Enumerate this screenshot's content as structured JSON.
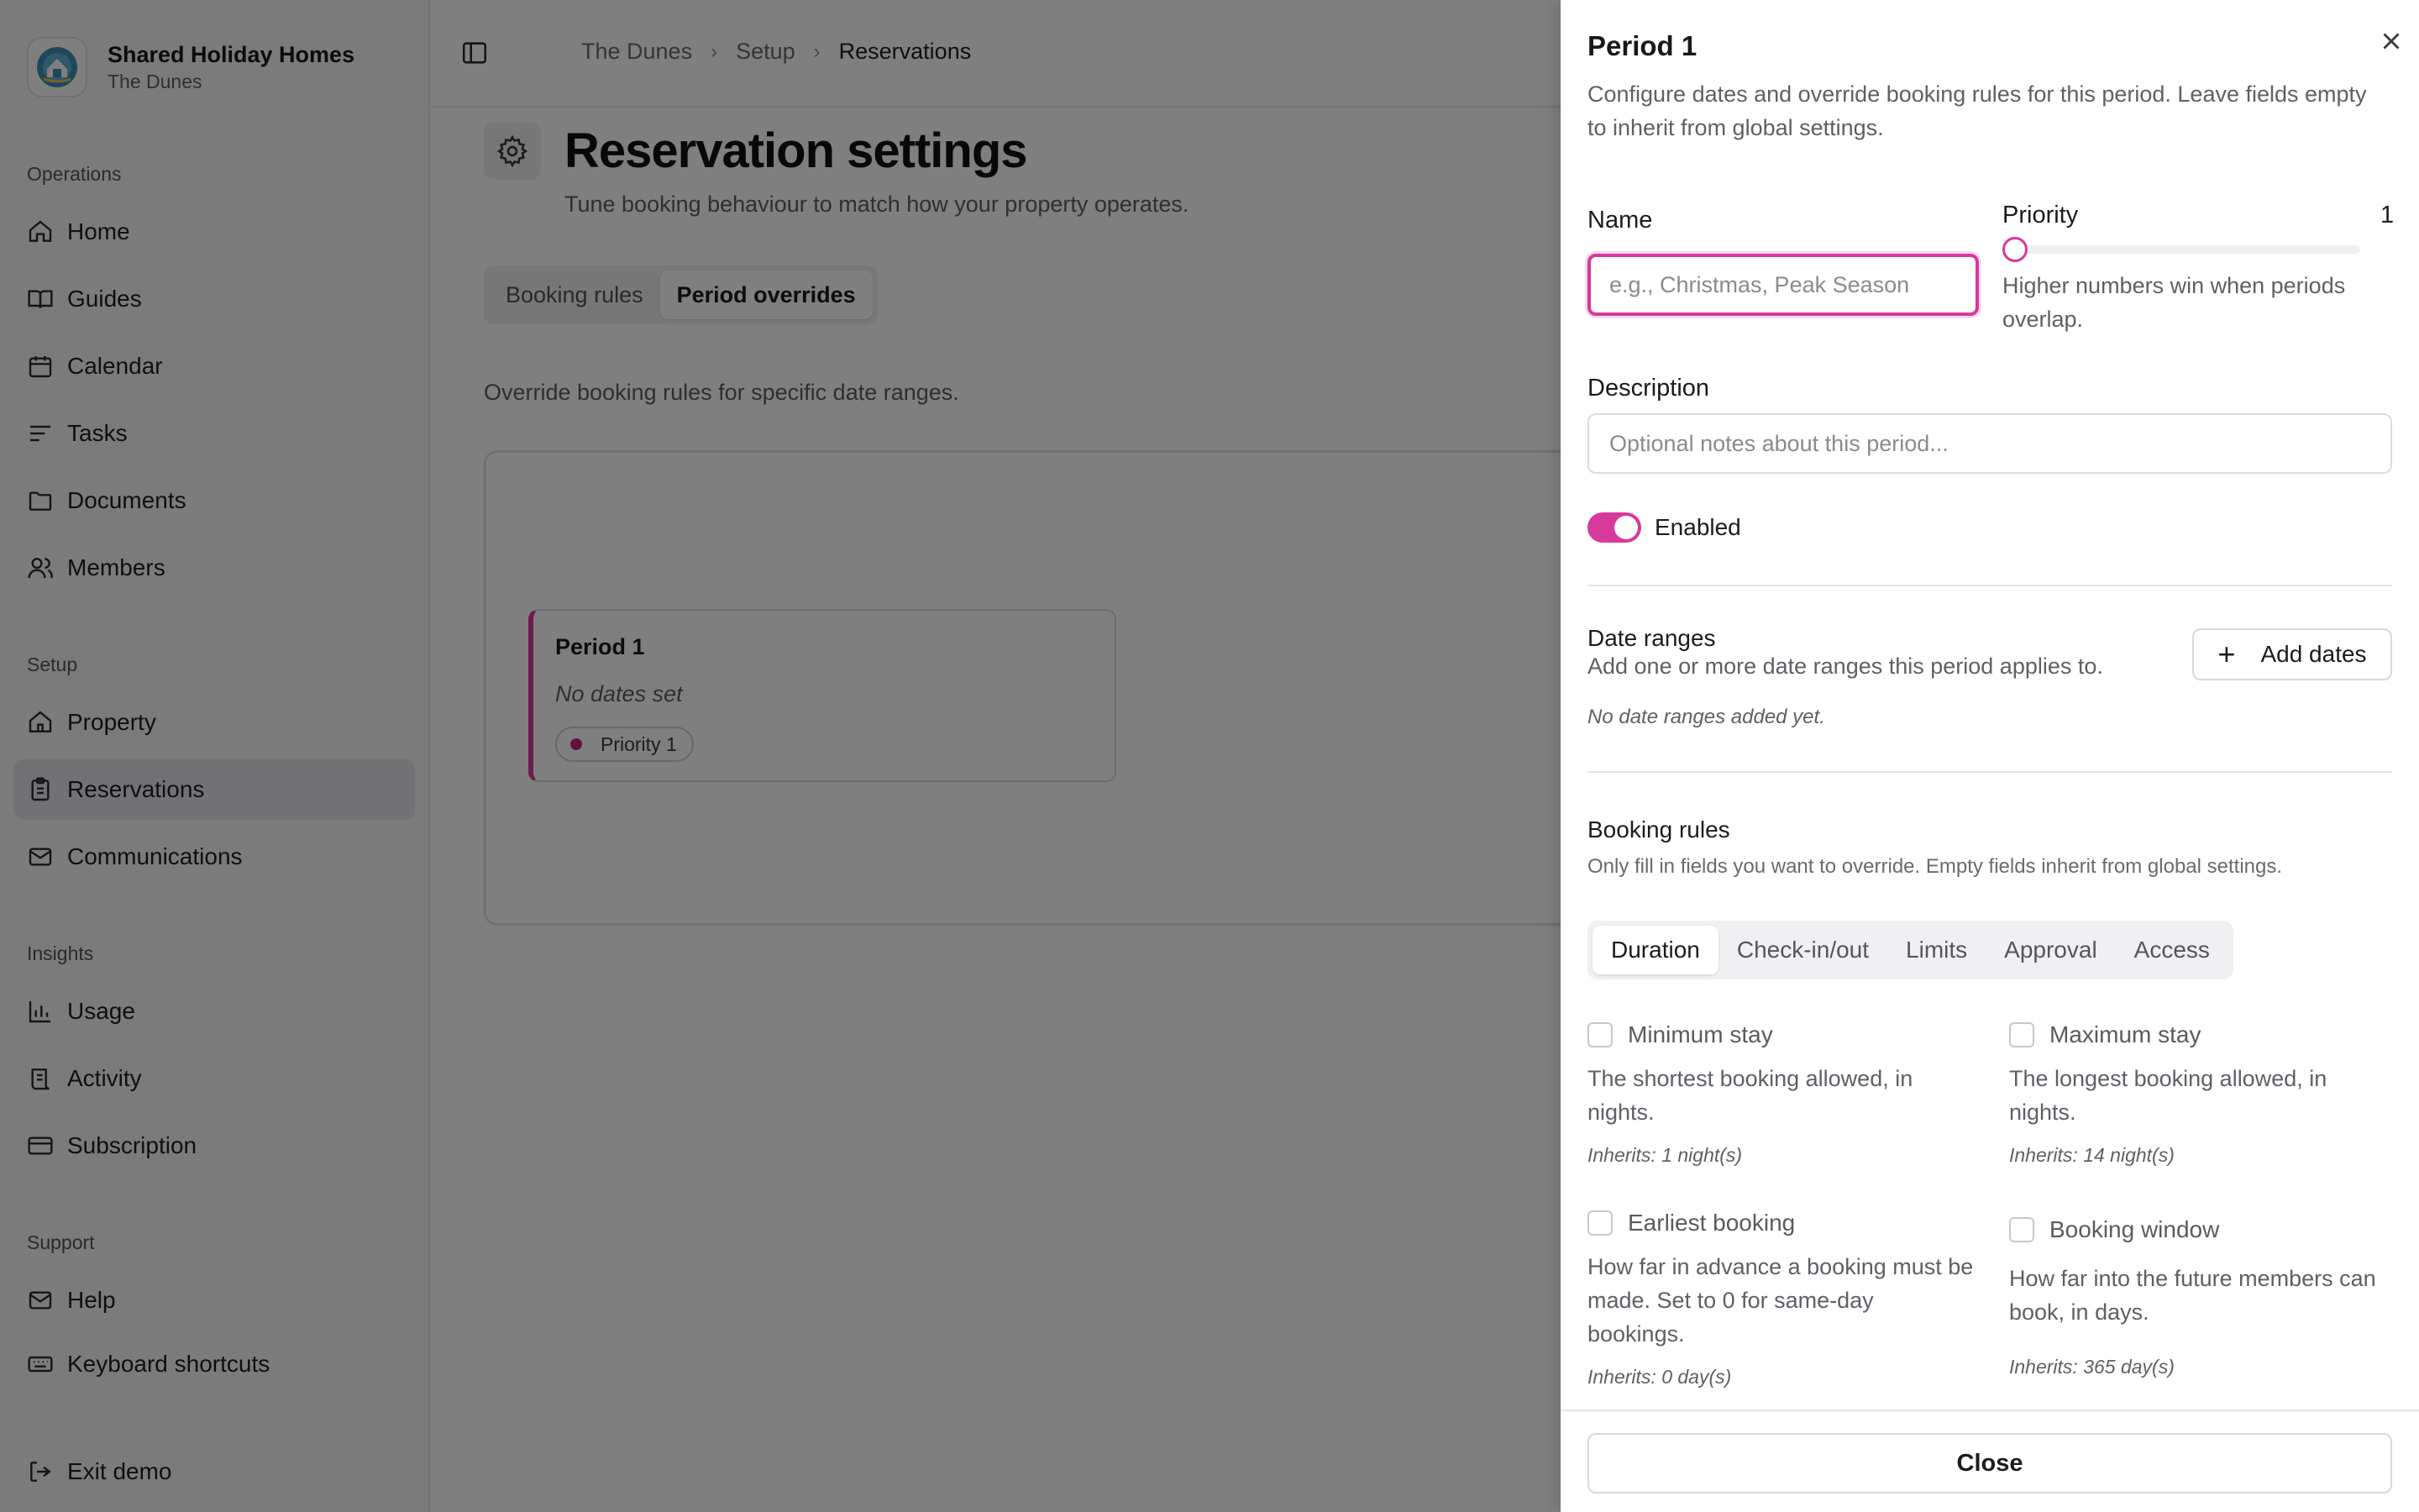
{
  "brand": {
    "name": "Shared Holiday Homes",
    "sub": "The Dunes"
  },
  "sidebar": {
    "sections": [
      {
        "label": "Operations",
        "items": [
          "Home",
          "Guides",
          "Calendar",
          "Tasks",
          "Documents",
          "Members"
        ]
      },
      {
        "label": "Setup",
        "items": [
          "Property",
          "Reservations",
          "Communications"
        ]
      },
      {
        "label": "Insights",
        "items": [
          "Usage",
          "Activity",
          "Subscription"
        ]
      },
      {
        "label": "Support",
        "items": [
          "Help",
          "Keyboard shortcuts"
        ]
      }
    ],
    "exit": "Exit demo",
    "active": "Reservations"
  },
  "breadcrumb": [
    "The Dunes",
    "Setup",
    "Reservations"
  ],
  "page": {
    "title": "Reservation settings",
    "subtitle": "Tune booking behaviour to match how your property operates.",
    "tabs": [
      "Booking rules",
      "Period overrides"
    ],
    "active_tab": "Period overrides",
    "override_text": "Override booking rules for specific date ranges.",
    "period_card": {
      "title": "Period 1",
      "dates": "No dates set",
      "badge": "Priority 1"
    }
  },
  "drawer": {
    "title": "Period 1",
    "description": "Configure dates and override booking rules for this period. Leave fields empty to inherit from global settings.",
    "name_label": "Name",
    "name_placeholder": "e.g., Christmas, Peak Season",
    "priority_label": "Priority",
    "priority_value": "1",
    "priority_help": "Higher numbers win when periods overlap.",
    "description_label": "Description",
    "description_placeholder": "Optional notes about this period...",
    "enabled_label": "Enabled",
    "enabled": true,
    "date_ranges_title": "Date ranges",
    "date_ranges_desc": "Add one or more date ranges this period applies to.",
    "add_dates_label": "Add dates",
    "no_ranges": "No date ranges added yet.",
    "rules_title": "Booking rules",
    "rules_desc": "Only fill in fields you want to override. Empty fields inherit from global settings.",
    "rule_tabs": [
      "Duration",
      "Check-in/out",
      "Limits",
      "Approval",
      "Access"
    ],
    "active_rule_tab": "Duration",
    "rules": [
      {
        "label": "Minimum stay",
        "desc": "The shortest booking allowed, in nights.",
        "inherit": "Inherits: 1 night(s)"
      },
      {
        "label": "Maximum stay",
        "desc": "The longest booking allowed, in nights.",
        "inherit": "Inherits: 14 night(s)"
      },
      {
        "label": "Earliest booking",
        "desc": "How far in advance a booking must be made. Set to 0 for same-day bookings.",
        "inherit": "Inherits: 0 day(s)"
      },
      {
        "label": "Booking window",
        "desc": "How far into the future members can book, in days.",
        "inherit": "Inherits: 365 day(s)"
      }
    ],
    "close_label": "Close"
  },
  "colors": {
    "accent": "#d7399b",
    "badge_dot": "#c2287f"
  }
}
